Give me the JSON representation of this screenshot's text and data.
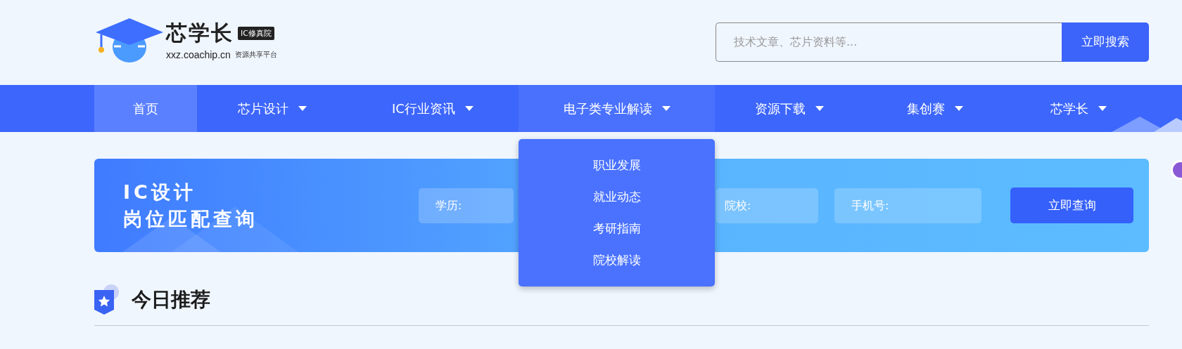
{
  "logo": {
    "name": "芯学长",
    "badge": "IC修真院",
    "domain": "xxz.coachip.cn",
    "slogan": "资源共享平台"
  },
  "search": {
    "placeholder": "技术文章、芯片资料等...",
    "button": "立即搜索"
  },
  "nav": [
    {
      "label": "首页",
      "kind": "link",
      "selected": true,
      "expanded": false
    },
    {
      "label": "芯片设计",
      "kind": "menu",
      "selected": false,
      "expanded": false
    },
    {
      "label": "IC行业资讯",
      "kind": "menu",
      "selected": false,
      "expanded": false
    },
    {
      "label": "电子类专业解读",
      "kind": "menu",
      "selected": false,
      "expanded": true,
      "menu": [
        "职业发展",
        "就业动态",
        "考研指南",
        "院校解读"
      ]
    },
    {
      "label": "资源下载",
      "kind": "menu",
      "selected": false,
      "expanded": false
    },
    {
      "label": "集创赛",
      "kind": "menu",
      "selected": false,
      "expanded": false
    },
    {
      "label": "芯学长",
      "kind": "menu",
      "selected": false,
      "expanded": false
    }
  ],
  "banner": {
    "title_lines": [
      "IC设计",
      "岗位匹配查询"
    ],
    "fields": [
      {
        "placeholder": "学历:"
      },
      {
        "placeholder": "院校:"
      },
      {
        "placeholder": "手机号:"
      }
    ],
    "button": "立即查询"
  },
  "section": {
    "title": "今日推荐"
  }
}
